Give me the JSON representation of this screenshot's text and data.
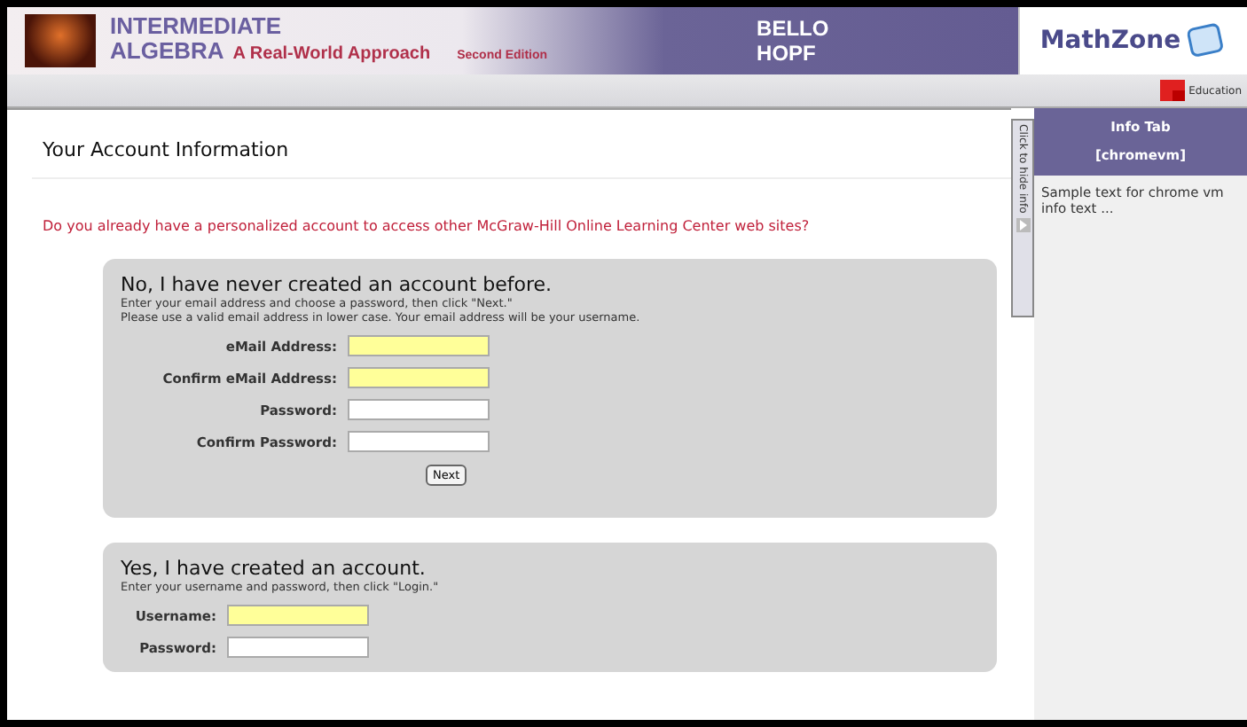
{
  "banner": {
    "title_line1": "INTERMEDIATE",
    "title_line2": "ALGEBRA",
    "subtitle": "A Real-World Approach",
    "edition": "Second Edition",
    "authors": [
      "BELLO",
      "HOPF"
    ]
  },
  "logo": {
    "text": "MathZone"
  },
  "publisher": {
    "text": "Education"
  },
  "page": {
    "heading": "Your Account Information",
    "question": "Do you already have a personalized account to access other McGraw-Hill Online Learning Center web sites?"
  },
  "new_account": {
    "heading": "No, I have never created an account before.",
    "instructions": [
      "Enter your email address and choose a password, then click \"Next.\"",
      "Please use a valid email address in lower case. Your email address will be your username."
    ],
    "fields": [
      {
        "label": "eMail Address:",
        "required": true
      },
      {
        "label": "Confirm eMail Address:",
        "required": true
      },
      {
        "label": "Password:",
        "required": false
      },
      {
        "label": "Confirm Password:",
        "required": false
      }
    ],
    "button": "Next"
  },
  "existing_account": {
    "heading": "Yes, I have created an account.",
    "instructions": [
      "Enter your username and password, then click \"Login.\""
    ],
    "fields": [
      {
        "label": "Username:",
        "required": true
      },
      {
        "label": "Password:",
        "required": false
      }
    ]
  },
  "info_toggle": {
    "label": "Click to hide info",
    "expanded": true
  },
  "info_panel": {
    "title": "Info Tab",
    "subtitle": "[chromevm]",
    "body": "Sample text for chrome vm info text ..."
  }
}
